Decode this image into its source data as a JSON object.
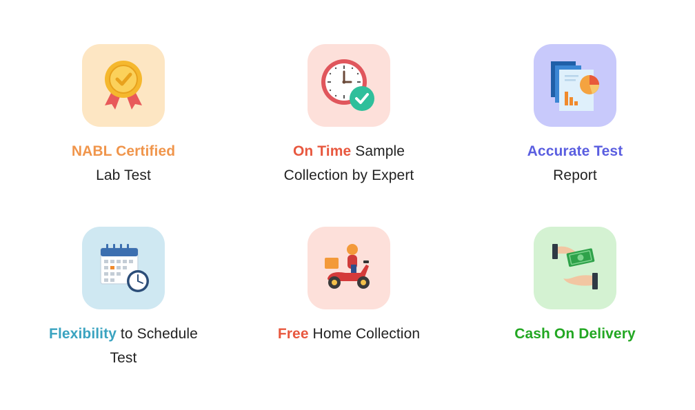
{
  "colors": {
    "nabl_tile": "#fde6c3",
    "ontime_tile": "#fde0da",
    "accurate_tile": "#c8c9fb",
    "flex_tile": "#cfe8f2",
    "free_tile": "#fde0da",
    "cash_tile": "#d4f2d2",
    "nabl_accent": "#f0954b",
    "ontime_accent": "#e8583f",
    "accurate_accent": "#5a5ee0",
    "flex_accent": "#3aa3c0",
    "free_accent": "#e8583f",
    "cash_accent": "#22a722"
  },
  "features": [
    {
      "icon": "award-medal-icon",
      "highlight": "NABL Certified",
      "rest_line1": "",
      "line2": "Lab Test"
    },
    {
      "icon": "clock-check-icon",
      "highlight": "On Time",
      "rest_line1": " Sample",
      "line2": "Collection by Expert"
    },
    {
      "icon": "report-chart-icon",
      "highlight": "Accurate Test",
      "rest_line1": "",
      "line2": "Report"
    },
    {
      "icon": "calendar-clock-icon",
      "highlight": "Flexibility",
      "rest_line1": " to Schedule",
      "line2": "Test"
    },
    {
      "icon": "delivery-scooter-icon",
      "highlight": "Free",
      "rest_line1": " Home Collection",
      "line2": ""
    },
    {
      "icon": "cash-hands-icon",
      "highlight": "Cash On Delivery",
      "rest_line1": "",
      "line2": ""
    }
  ]
}
